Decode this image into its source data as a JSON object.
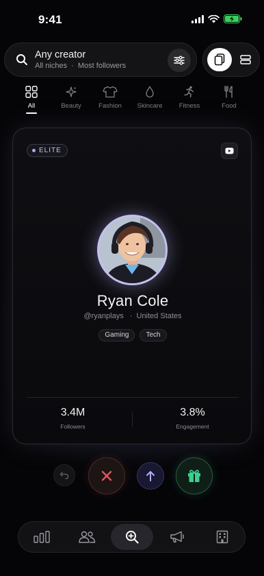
{
  "status_bar": {
    "time": "9:41"
  },
  "search": {
    "title": "Any creator",
    "niches": "All niches",
    "sort": "Most followers",
    "separator": "·"
  },
  "categories": [
    {
      "label": "All",
      "icon": "grid-icon",
      "active": true
    },
    {
      "label": "Beauty",
      "icon": "sparkle-icon",
      "active": false
    },
    {
      "label": "Fashion",
      "icon": "tshirt-icon",
      "active": false
    },
    {
      "label": "Skincare",
      "icon": "droplet-icon",
      "active": false
    },
    {
      "label": "Fitness",
      "icon": "running-icon",
      "active": false
    },
    {
      "label": "Food",
      "icon": "fork-knife-icon",
      "active": false
    }
  ],
  "creator": {
    "badge": "ELITE",
    "platform_icon": "youtube-icon",
    "name": "Ryan Cole",
    "handle": "@ryanplays",
    "location": "United States",
    "tags": [
      "Gaming",
      "Tech"
    ],
    "stats": [
      {
        "value": "3.4M",
        "label": "Followers"
      },
      {
        "value": "3.8%",
        "label": "Engagement"
      }
    ]
  },
  "actions": [
    "undo-icon",
    "close-icon",
    "arrow-up-icon",
    "gift-icon"
  ],
  "bottom_nav": [
    {
      "icon": "bar-chart-icon",
      "active": false
    },
    {
      "icon": "users-icon",
      "active": false
    },
    {
      "icon": "search-zoom-icon",
      "active": true
    },
    {
      "icon": "megaphone-icon",
      "active": false
    },
    {
      "icon": "building-icon",
      "active": false
    }
  ],
  "colors": {
    "accent": "#a9a6f5",
    "reject": "#e05a5a",
    "gift": "#3ccf8e",
    "background": "#050507"
  }
}
